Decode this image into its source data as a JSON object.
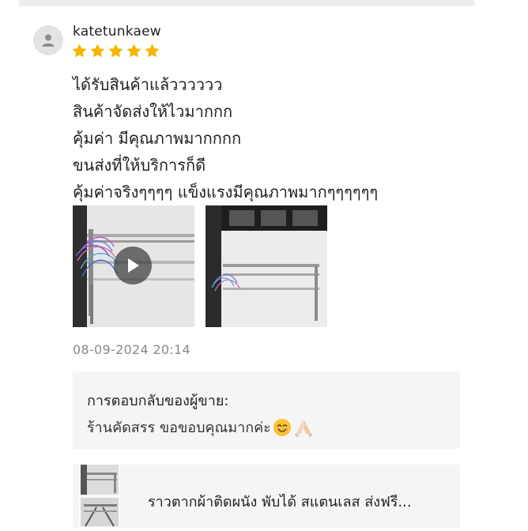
{
  "review": {
    "username": "katetunkaew",
    "rating": 5,
    "lines": [
      "ได้รับสินค้าแล้วววววว",
      "สินค้าจัดส่งให้ไวมากกก",
      "คุ้มค่า มีคุณภาพมากกกก",
      "ขนส่งที่ให้บริการก็ดี",
      "คุ้มค่าจริงๆๆๆๆ แข็งแรงมีคุณภาพมากๆๆๆๆๆๆ"
    ],
    "timestamp": "08-09-2024 20:14",
    "media": [
      {
        "kind": "video",
        "icon": "play-icon"
      },
      {
        "kind": "photo"
      }
    ]
  },
  "seller_reply": {
    "title": "การตอบกลับของผู้ขาย:",
    "text": "ร้านคัดสรร  ขอขอบคุณมากค่ะ",
    "emojis": [
      "smiling-face-icon",
      "folded-hands-icon"
    ]
  },
  "product": {
    "title": "ราวตากผ้าติดผนัง พับได้ สแตนเลส ส่งฟรี..."
  },
  "colors": {
    "star": "#f7b500",
    "timestamp": "#8a8a8a",
    "reply_bg": "#f5f5f5",
    "avatar_bg": "#e3e3e3"
  }
}
